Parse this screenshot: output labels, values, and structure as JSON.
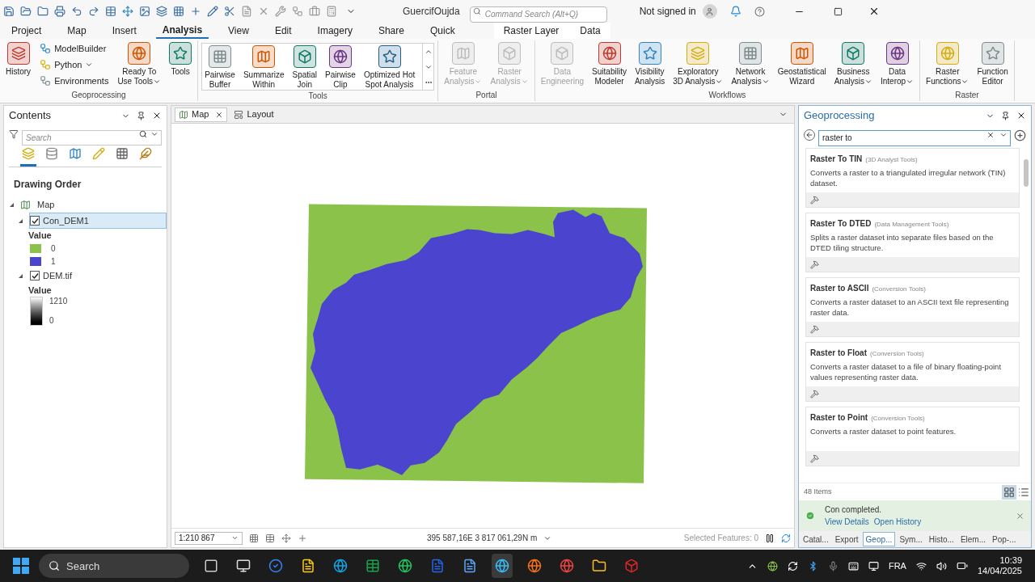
{
  "title_bar": {
    "project": "GuercifOujda",
    "command_search": {
      "placeholder": "Command Search (Alt+Q)"
    },
    "account": "Not signed in"
  },
  "ribbon_tabs": [
    {
      "label": "Project",
      "selected": false
    },
    {
      "label": "Map",
      "selected": false
    },
    {
      "label": "Insert",
      "selected": false
    },
    {
      "label": "Analysis",
      "selected": true
    },
    {
      "label": "View",
      "selected": false
    },
    {
      "label": "Edit",
      "selected": false
    },
    {
      "label": "Imagery",
      "selected": false
    },
    {
      "label": "Share",
      "selected": false
    },
    {
      "label": "Quick",
      "selected": false
    }
  ],
  "contextual_tabs": [
    {
      "label": "Raster Layer",
      "selected": false
    },
    {
      "label": "Data",
      "selected": false
    }
  ],
  "ribbon_groups": [
    {
      "title": "Geoprocessing",
      "buttons": [
        {
          "kind": "large",
          "label": "History",
          "disabled": false,
          "dropdown": false
        },
        {
          "kind": "small",
          "label": "ModelBuilder",
          "disabled": false,
          "dropdown": false
        },
        {
          "kind": "small",
          "label": "Python",
          "disabled": false,
          "dropdown": true
        },
        {
          "kind": "small",
          "label": "Environments",
          "disabled": false,
          "dropdown": false
        },
        {
          "kind": "large",
          "label": "Ready To\nUse Tools",
          "disabled": false,
          "dropdown": true
        },
        {
          "kind": "large",
          "label": "Tools",
          "disabled": false,
          "dropdown": false
        }
      ]
    },
    {
      "title": "Tools",
      "buttons": [
        {
          "kind": "gallery",
          "label": "Pairwise\nBuffer",
          "disabled": false,
          "dropdown": false
        },
        {
          "kind": "gallery",
          "label": "Summarize\nWithin",
          "disabled": false,
          "dropdown": false
        },
        {
          "kind": "gallery",
          "label": "Spatial\nJoin",
          "disabled": false,
          "dropdown": false
        },
        {
          "kind": "gallery",
          "label": "Pairwise\nClip",
          "disabled": false,
          "dropdown": false
        },
        {
          "kind": "gallery",
          "label": "Optimized Hot\nSpot Analysis",
          "disabled": false,
          "dropdown": false
        }
      ]
    },
    {
      "title": "Portal",
      "buttons": [
        {
          "kind": "large",
          "label": "Feature\nAnalysis",
          "disabled": true,
          "dropdown": true
        },
        {
          "kind": "large",
          "label": "Raster\nAnalysis",
          "disabled": true,
          "dropdown": true
        }
      ]
    },
    {
      "title": "Workflows",
      "buttons": [
        {
          "kind": "large",
          "label": "Data\nEngineering",
          "disabled": true,
          "dropdown": false
        },
        {
          "kind": "large",
          "label": "Suitability\nModeler",
          "disabled": false,
          "dropdown": false
        },
        {
          "kind": "large",
          "label": "Visibility\nAnalysis",
          "disabled": false,
          "dropdown": false
        },
        {
          "kind": "large",
          "label": "Exploratory\n3D Analysis",
          "disabled": false,
          "dropdown": true
        },
        {
          "kind": "large",
          "label": "Network\nAnalysis",
          "disabled": false,
          "dropdown": true
        },
        {
          "kind": "large",
          "label": "Geostatistical\nWizard",
          "disabled": false,
          "dropdown": false
        },
        {
          "kind": "large",
          "label": "Business\nAnalysis",
          "disabled": false,
          "dropdown": true
        },
        {
          "kind": "large",
          "label": "Data\nInterop",
          "disabled": false,
          "dropdown": true
        }
      ]
    },
    {
      "title": "Raster",
      "buttons": [
        {
          "kind": "large",
          "label": "Raster\nFunctions",
          "disabled": false,
          "dropdown": true
        },
        {
          "kind": "large",
          "label": "Function\nEditor",
          "disabled": false,
          "dropdown": false
        }
      ]
    }
  ],
  "contents": {
    "title": "Contents",
    "search": {
      "placeholder": "Search"
    },
    "view_buttons": [
      {
        "selected": true
      },
      {
        "selected": false
      },
      {
        "selected": false
      },
      {
        "selected": false
      },
      {
        "selected": false
      },
      {
        "selected": false
      }
    ],
    "heading": "Drawing Order",
    "tree": [
      {
        "label": "Map",
        "kind": "map",
        "expanded": true,
        "selected": false,
        "children": [
          {
            "label": "Con_DEM1",
            "kind": "layer",
            "expanded": true,
            "checked": true,
            "selected": true,
            "legend": {
              "kind": "classes",
              "title": "Value",
              "classes": [
                {
                  "label": "0",
                  "color": "#8bc34a"
                },
                {
                  "label": "1",
                  "color": "#4b44cf"
                }
              ]
            }
          },
          {
            "label": "DEM.tif",
            "kind": "layer",
            "expanded": true,
            "checked": true,
            "selected": false,
            "legend": {
              "kind": "stretch",
              "title": "Value",
              "high": "1210",
              "low": "0"
            }
          }
        ]
      }
    ]
  },
  "map_view": {
    "tabs": [
      {
        "label": "Map",
        "selected": true,
        "closable": true
      },
      {
        "label": "Layout",
        "selected": false,
        "closable": false
      }
    ],
    "scale": "1:210 867",
    "coordinates": "395 587,16E 3 817 061,29N m",
    "selected_features": "Selected Features: 0"
  },
  "geoprocessing": {
    "title": "Geoprocessing",
    "search": {
      "value": "raster to"
    },
    "results": [
      {
        "name": "Raster To TIN",
        "toolbox": "(3D Analyst Tools)",
        "description": "Converts a raster to a triangulated  irregular network (TIN) dataset."
      },
      {
        "name": "Raster To DTED",
        "toolbox": "(Data Management Tools)",
        "description": "Splits a raster dataset into separate files based on the DTED tiling structure."
      },
      {
        "name": "Raster to ASCII",
        "toolbox": "(Conversion Tools)",
        "description": "Converts a raster dataset to an ASCII text file representing raster data."
      },
      {
        "name": "Raster to Float",
        "toolbox": "(Conversion Tools)",
        "description": "Converts a raster dataset to a file of binary floating-point values representing raster data."
      },
      {
        "name": "Raster to Point",
        "toolbox": "(Conversion Tools)",
        "description": "Converts a raster dataset to point features."
      }
    ],
    "count": "48 Items",
    "notification": {
      "message": "Con completed.",
      "links": [
        "View Details",
        "Open History"
      ]
    },
    "pane_tabs": [
      {
        "label": "Catal...",
        "selected": false
      },
      {
        "label": "Export",
        "selected": false
      },
      {
        "label": "Geop...",
        "selected": true
      },
      {
        "label": "Sym...",
        "selected": false
      },
      {
        "label": "Histo...",
        "selected": false
      },
      {
        "label": "Elem...",
        "selected": false
      },
      {
        "label": "Pop-...",
        "selected": false
      }
    ]
  },
  "taskbar": {
    "search": {
      "placeholder": "Search"
    },
    "apps": [
      {
        "active": false
      },
      {
        "active": false
      },
      {
        "active": false
      },
      {
        "active": false
      },
      {
        "active": false
      },
      {
        "active": false
      },
      {
        "active": false
      },
      {
        "active": false
      },
      {
        "active": false
      },
      {
        "active": true
      },
      {
        "active": false
      },
      {
        "active": false
      },
      {
        "active": false
      },
      {
        "active": false
      }
    ],
    "language": "FRA",
    "time": "10:39",
    "date": "14/04/2025"
  }
}
